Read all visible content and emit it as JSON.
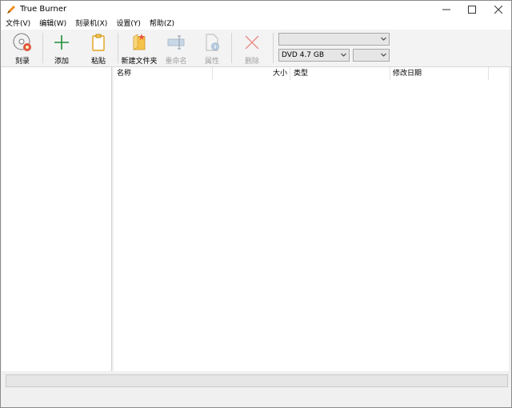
{
  "window": {
    "title": "True Burner"
  },
  "menu": [
    {
      "label": "文件(V)"
    },
    {
      "label": "编辑(W)"
    },
    {
      "label": "刻录机(X)"
    },
    {
      "label": "设置(Y)"
    },
    {
      "label": "帮助(Z)"
    }
  ],
  "toolbar": {
    "burn": "刻录",
    "add": "添加",
    "paste": "粘贴",
    "new_folder": "新建文件夹",
    "rename": "重命名",
    "properties": "属性",
    "delete": "删除",
    "drive_select": "",
    "disc_type": "DVD 4.7 GB",
    "speed_select": ""
  },
  "columns": {
    "name": "名称",
    "size": "大小",
    "type": "类型",
    "modified": "修改日期"
  },
  "colors": {
    "disabled_text": "#a0a0a0",
    "add_icon": "#1e8f3a",
    "delete_icon": "#e05a5a",
    "folder": "#f6c34a"
  }
}
